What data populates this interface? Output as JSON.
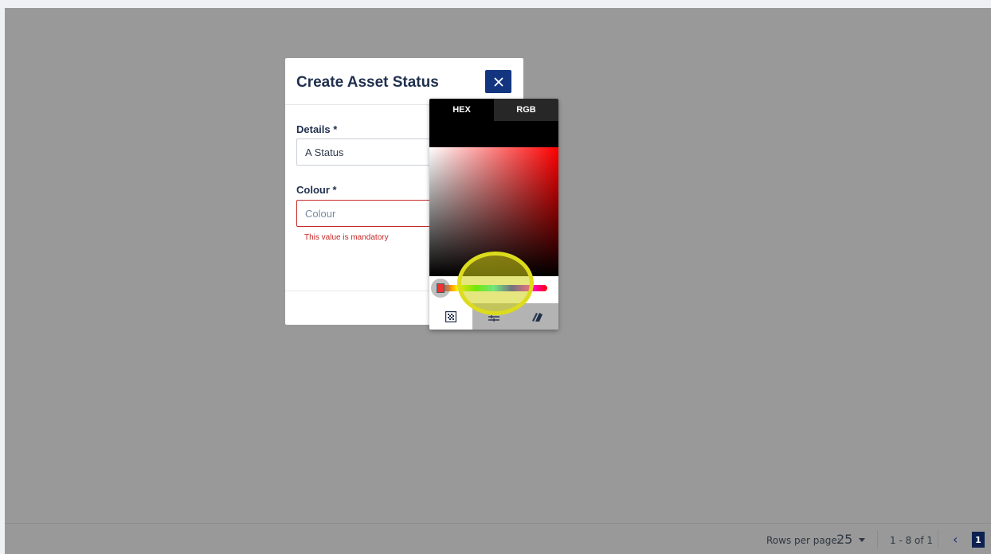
{
  "dialog": {
    "title": "Create Asset Status",
    "close_icon": "close-icon",
    "details_label": "Details *",
    "details_value": "A Status",
    "colour_label": "Colour *",
    "colour_placeholder": "Colour",
    "colour_error": "This value is mandatory"
  },
  "color_picker": {
    "tabs": [
      {
        "label": "HEX",
        "active": true
      },
      {
        "label": "RGB",
        "active": false
      }
    ],
    "hue_value": "#ff0000",
    "bottom_tabs": [
      {
        "icon": "palette-grid-icon",
        "selected": true
      },
      {
        "icon": "sliders-icon",
        "selected": false
      },
      {
        "icon": "swatches-icon",
        "selected": false
      }
    ]
  },
  "footer": {
    "rows_per_page_label": "Rows per page:",
    "rows_per_page_value": "25",
    "range_text": "1 - 8 of 1",
    "prev_icon": "chevron-left-icon",
    "current_page": "1"
  },
  "colors": {
    "overlay": "#999999",
    "accent": "#13357f",
    "error": "#c62828",
    "highlight": "#dcdc1c"
  }
}
